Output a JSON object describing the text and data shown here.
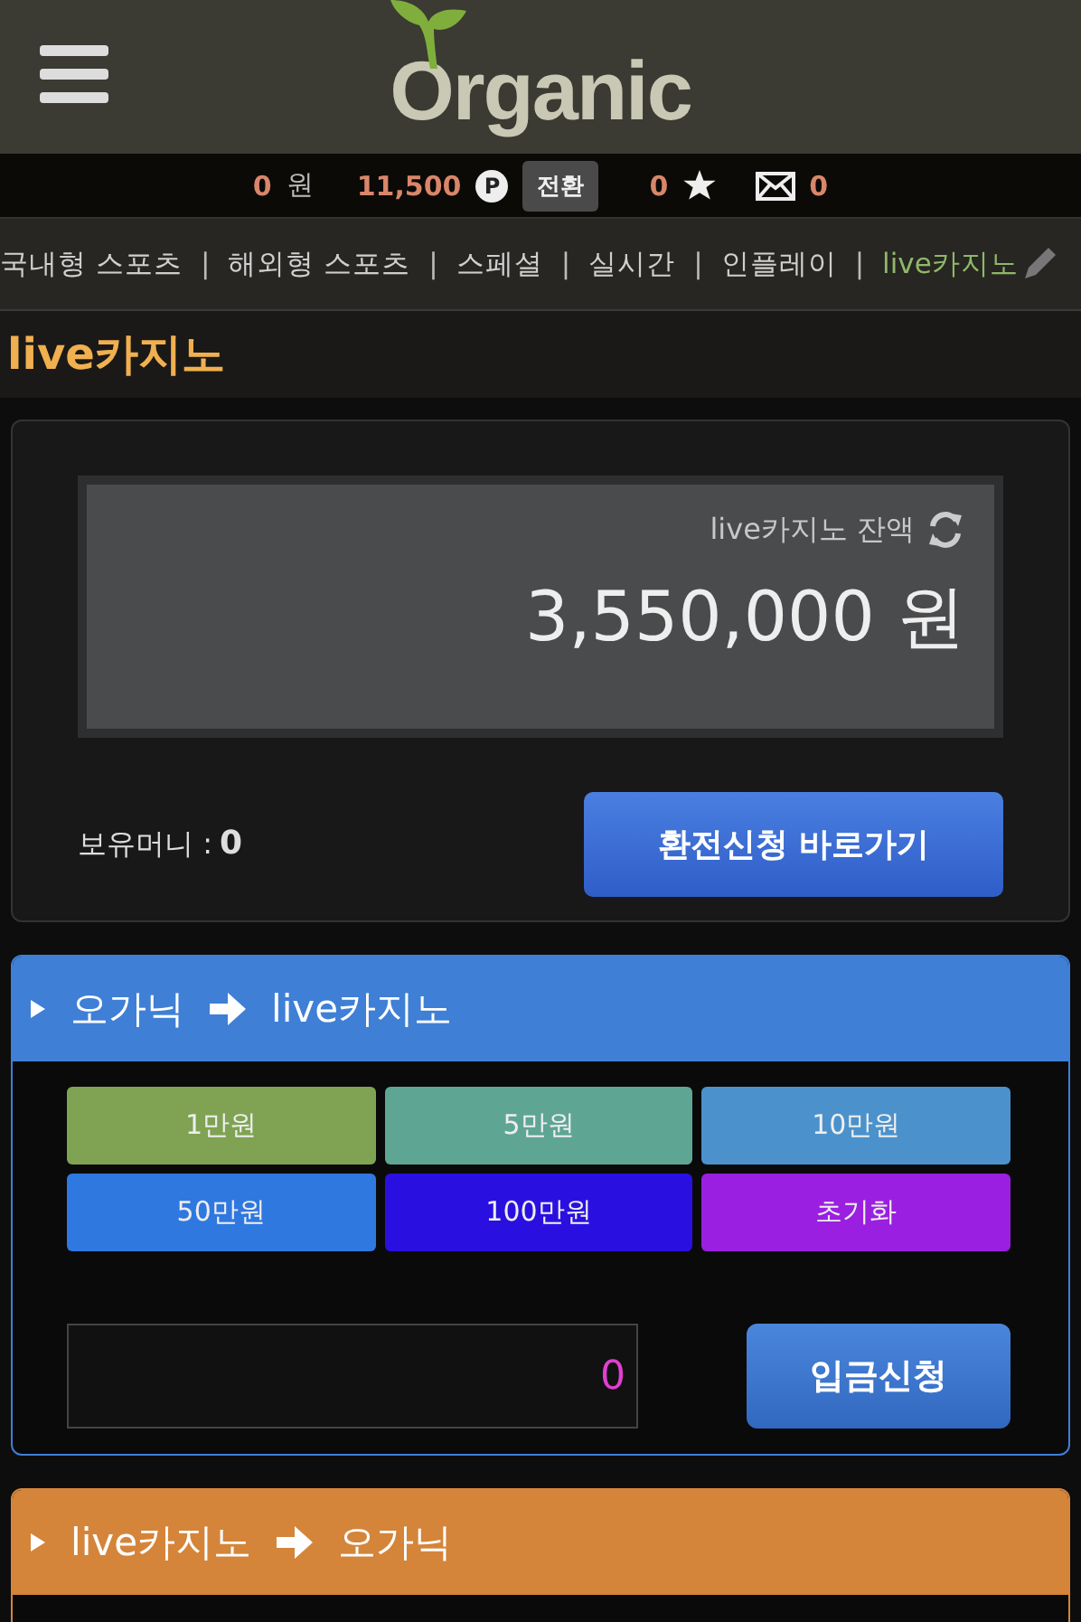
{
  "header": {
    "logo": "Organic"
  },
  "account_bar": {
    "cash": "0",
    "cash_unit": "원",
    "points": "11,500",
    "points_icon": "P",
    "convert_button": "전환",
    "stars": "0",
    "messages": "0"
  },
  "nav_separator": "|",
  "nav": [
    {
      "label": "국내형 스포츠",
      "selected": false
    },
    {
      "label": "해외형 스포츠",
      "selected": false
    },
    {
      "label": "스페셜",
      "selected": false
    },
    {
      "label": "실시간",
      "selected": false
    },
    {
      "label": "인플레이",
      "selected": false
    },
    {
      "label": "live카지노",
      "selected": true
    }
  ],
  "page_title": "live카지노",
  "balance_card": {
    "label": "live카지노 잔액",
    "amount": "3,550,000 원",
    "held_label": "보유머니 :",
    "held_value": "0",
    "exchange_button": "환전신청 바로가기"
  },
  "panels": [
    {
      "kind": "deposit",
      "color": "#3f7fd6",
      "from": "오가닉",
      "to": "live카지노",
      "amount_buttons": [
        {
          "label": "1만원",
          "color": "#7fa352"
        },
        {
          "label": "5만원",
          "color": "#5fa594"
        },
        {
          "label": "10만원",
          "color": "#4b92cc"
        },
        {
          "label": "50만원",
          "color": "#2f78e0"
        },
        {
          "label": "100만원",
          "color": "#2a10e0"
        },
        {
          "label": "초기화",
          "color": "#9a1fe0"
        }
      ],
      "amount_value": "0",
      "submit_button": "입금신청"
    },
    {
      "kind": "withdraw",
      "color": "#d4853a",
      "from": "live카지노",
      "to": "오가닉"
    }
  ]
}
